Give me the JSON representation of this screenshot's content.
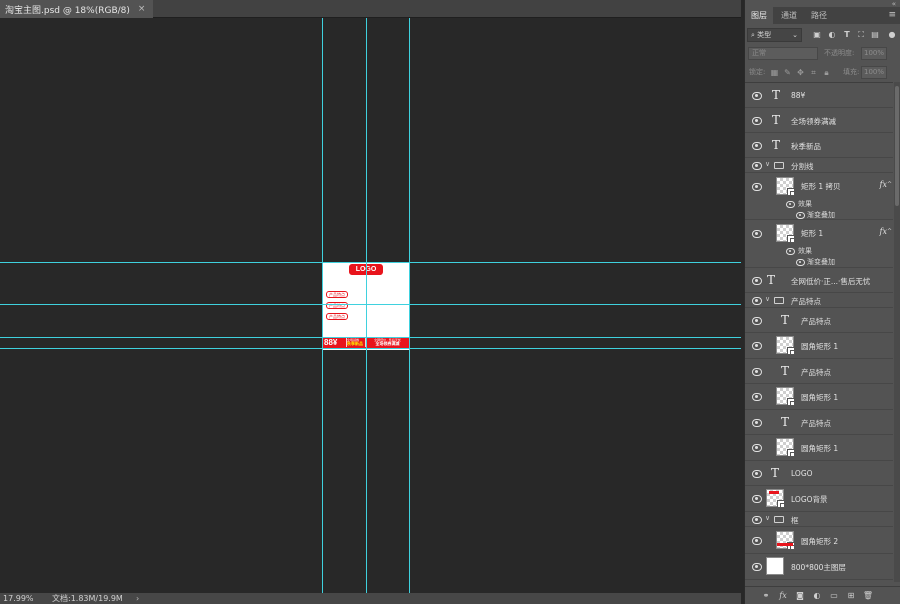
{
  "document_tab": {
    "title": "淘宝主图.psd @ 18%(RGB/8)",
    "close": "×"
  },
  "artboard": {
    "logo": "LOGO",
    "features": [
      "产品特点",
      "产品特点",
      "产品特点"
    ],
    "price": "88¥",
    "sub_a_top": "全场领券",
    "sub_a_bottom": "秋季新品",
    "sub_b_top": "全网低价 · 售后无忧",
    "sub_b_bottom": "全场领券满减"
  },
  "status_bar": {
    "zoom": "17.99%",
    "doc_info": "文档:1.83M/19.9M",
    "arrow": "›"
  },
  "panel": {
    "tabs": [
      "图层",
      "通道",
      "路径"
    ],
    "active_tab": "图层",
    "menu": "≡",
    "collapse": "«",
    "filter_label": "类型",
    "blend_mode": "正常",
    "opacity_label": "不透明度:",
    "opacity_value": "100%",
    "lock_label": "锁定:",
    "fill_label": "填充:",
    "fill_value": "100%"
  },
  "layers": {
    "l0": "88¥",
    "l1": "全场领券满减",
    "l2": "秋季新品",
    "g_divider": "分割线",
    "l3": "矩形 1 拷贝",
    "l3_effects": "效果",
    "l3_effect": "渐变叠加",
    "l4": "矩形 1",
    "l4_effects": "效果",
    "l4_effect": "渐变叠加",
    "l5": "全网低价·正...·售后无忧",
    "g_features": "产品特点",
    "l6": "产品特点",
    "l7": "圆角矩形 1",
    "l8": "产品特点",
    "l9": "圆角矩形 1",
    "l10": "产品特点",
    "l11": "圆角矩形 1",
    "l12": "LOGO",
    "l13": "LOGO背景",
    "g_frame": "框",
    "l14": "圆角矩形 2",
    "l15": "800*800主图层",
    "fx": "fx"
  },
  "colors": {
    "accent_red": "#e8141c",
    "guide": "#3fd1de",
    "panel_bg": "#535353",
    "canvas_bg": "#282828"
  }
}
